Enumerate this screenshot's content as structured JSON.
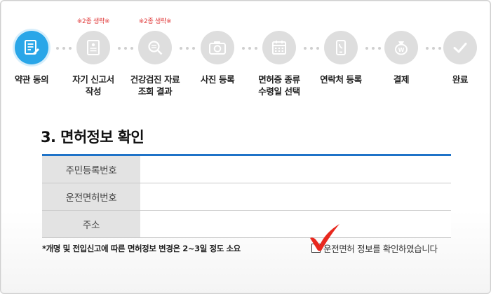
{
  "steps": [
    {
      "label_1": "약관 동의",
      "label_2": "",
      "note": "",
      "icon": "document-edit-icon",
      "active": true
    },
    {
      "label_1": "자기 신고서",
      "label_2": "작성",
      "note": "※2종 생략※",
      "icon": "form-document-icon",
      "active": false
    },
    {
      "label_1": "건강검진 자료",
      "label_2": "조회 결과",
      "note": "※2종 생략※",
      "icon": "search-icon",
      "active": false
    },
    {
      "label_1": "사진 등록",
      "label_2": "",
      "note": "",
      "icon": "camera-icon",
      "active": false
    },
    {
      "label_1": "면허증 종류",
      "label_2": "수령일 선택",
      "note": "",
      "icon": "calendar-icon",
      "active": false
    },
    {
      "label_1": "연락처 등록",
      "label_2": "",
      "note": "",
      "icon": "phone-icon",
      "active": false
    },
    {
      "label_1": "결제",
      "label_2": "",
      "note": "",
      "icon": "payment-bag-icon",
      "active": false
    },
    {
      "label_1": "완료",
      "label_2": "",
      "note": "",
      "icon": "check-icon",
      "active": false
    }
  ],
  "section": {
    "title": "3. 면허정보 확인"
  },
  "form": {
    "rows": [
      {
        "label": "주민등록번호",
        "value": ""
      },
      {
        "label": "운전면허번호",
        "value": ""
      },
      {
        "label": "주소",
        "value": ""
      }
    ]
  },
  "notice": "*개명 및 전입신고에 따른 면허정보 변경은 2~3일 정도 소요",
  "confirm": {
    "label": "운전면허 정보를 확인하였습니다"
  },
  "colors": {
    "active_step": "#2aa6e8",
    "inactive_step": "#dedede",
    "table_top_border": "#1f73c8",
    "note_red": "#e03a3a",
    "checkmark_red": "#e8281e"
  }
}
